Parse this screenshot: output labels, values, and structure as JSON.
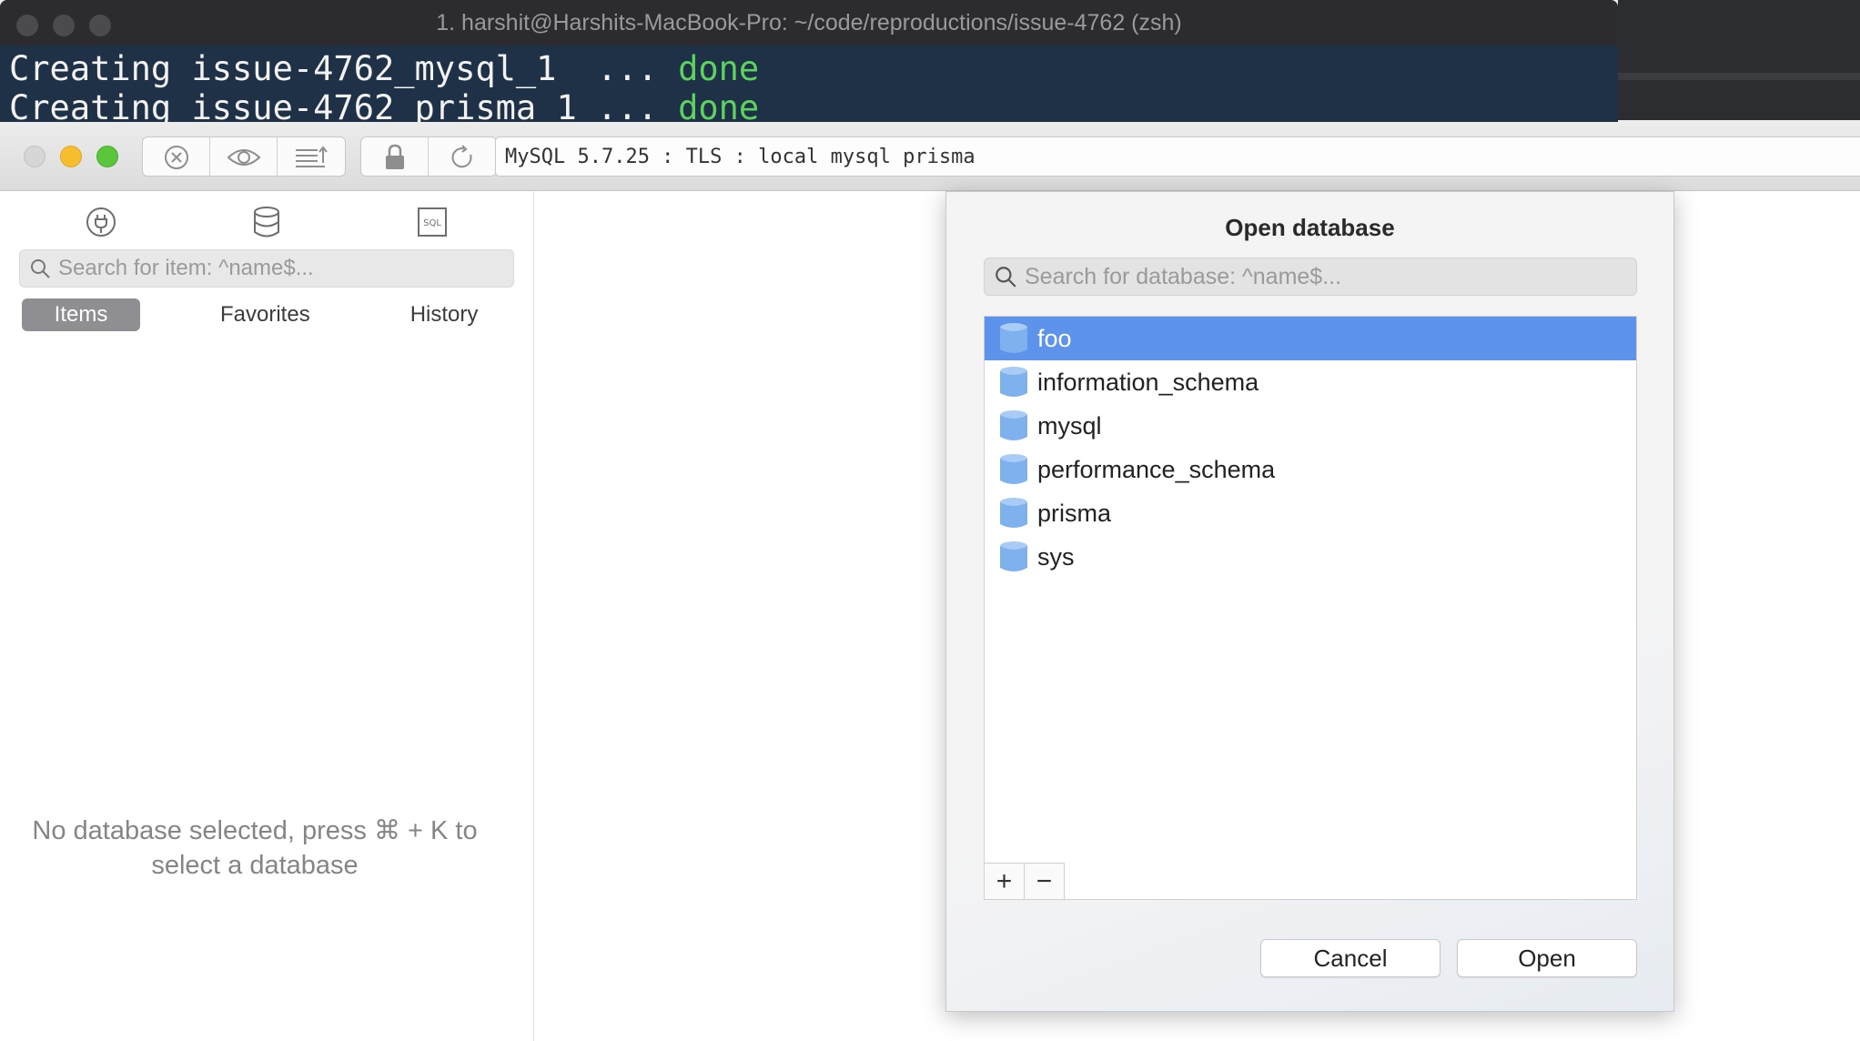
{
  "terminal": {
    "title": "1. harshit@Harshits-MacBook-Pro: ~/code/reproductions/issue-4762 (zsh)",
    "lines": [
      {
        "text": "Creating issue-4762_mysql_1  ... ",
        "status": "done"
      },
      {
        "text": "Creating issue-4762_prisma_1 ... ",
        "status": "done"
      }
    ]
  },
  "toolbar": {
    "connection_label": "MySQL 5.7.25 : TLS : local mysql prisma"
  },
  "sidebar": {
    "search_placeholder": "Search for item: ^name$...",
    "tabs": [
      {
        "label": "Items",
        "active": true
      },
      {
        "label": "Favorites",
        "active": false
      },
      {
        "label": "History",
        "active": false
      }
    ],
    "empty_message": "No database selected, press ⌘ + K to select a database"
  },
  "dialog": {
    "title": "Open database",
    "search_placeholder": "Search for database: ^name$...",
    "databases": [
      {
        "name": "foo",
        "selected": true
      },
      {
        "name": "information_schema",
        "selected": false
      },
      {
        "name": "mysql",
        "selected": false
      },
      {
        "name": "performance_schema",
        "selected": false
      },
      {
        "name": "prisma",
        "selected": false
      },
      {
        "name": "sys",
        "selected": false
      }
    ],
    "add_label": "+",
    "remove_label": "−",
    "cancel_label": "Cancel",
    "open_label": "Open"
  },
  "colors": {
    "selection": "#5d93eb",
    "terminal_bg": "#1f3147",
    "terminal_done": "#5bd35e"
  }
}
